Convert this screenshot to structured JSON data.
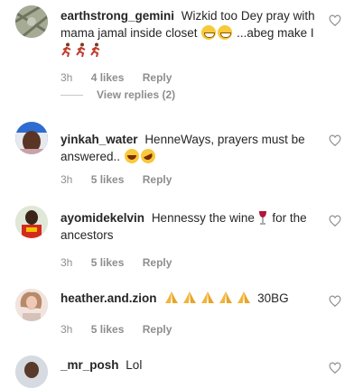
{
  "comments": [
    {
      "username": "earthstrong_gemini",
      "text_1": "Wizkid too Dey pray with mama jamal inside closet",
      "text_2": "...abeg make I",
      "time": "3h",
      "likes": "4 likes",
      "reply": "Reply",
      "view_replies": "View replies (2)"
    },
    {
      "username": "yinkah_water",
      "text_1": "HenneWays, prayers must be answered..",
      "time": "3h",
      "likes": "5 likes",
      "reply": "Reply"
    },
    {
      "username": "ayomidekelvin",
      "text_1": "Hennessy the wine",
      "text_2": "for the ancestors",
      "time": "3h",
      "likes": "5 likes",
      "reply": "Reply"
    },
    {
      "username": "heather.and.zion",
      "text_1": "30BG",
      "time": "3h",
      "likes": "5 likes",
      "reply": "Reply"
    },
    {
      "username": "_mr_posh",
      "text_1": "Lol"
    }
  ],
  "icons": {
    "heart": "heart-outline-icon",
    "grin": "grinning-face-emoji",
    "laugh": "rolling-laughing-emoji",
    "runner": "running-man-emoji",
    "pray": "folded-hands-emoji",
    "wine": "wine-glass-emoji"
  },
  "colors": {
    "muted": "#8e8e8e",
    "text": "#262626"
  }
}
